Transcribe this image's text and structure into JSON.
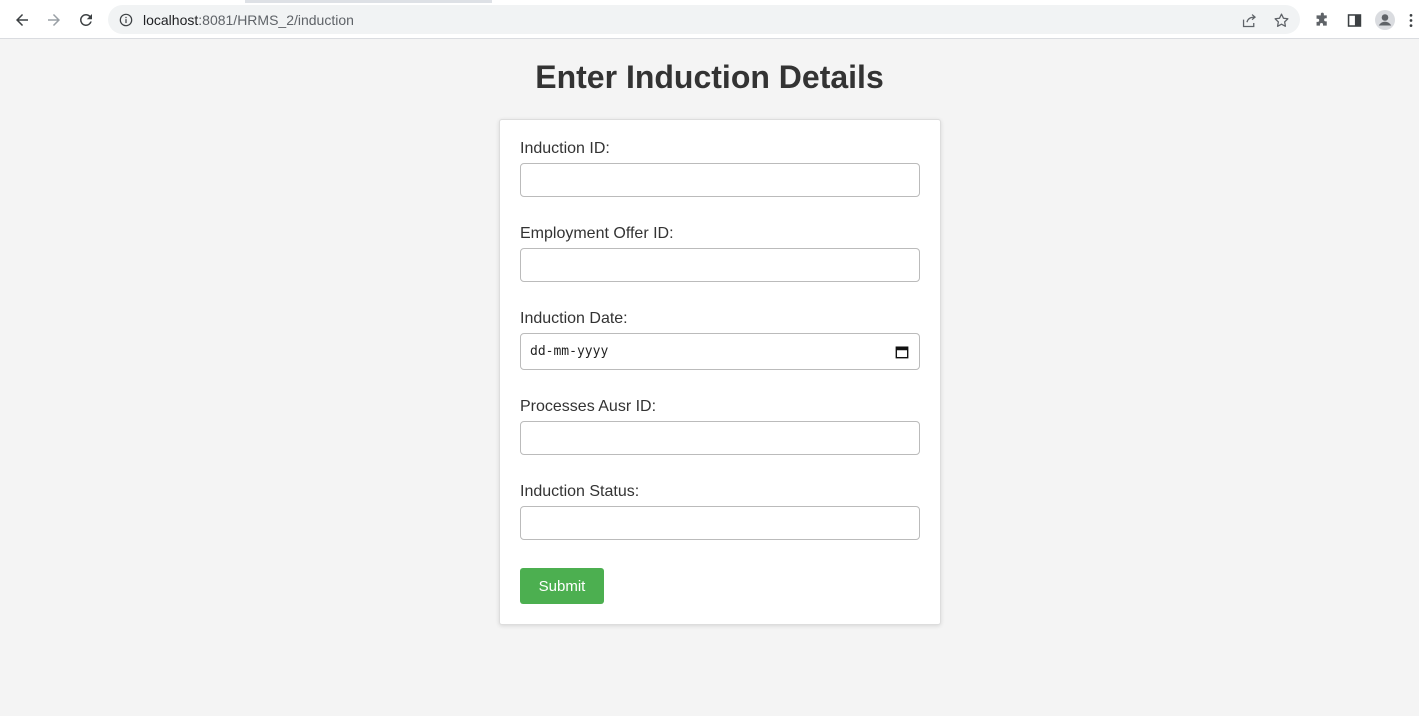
{
  "browser": {
    "url_host": "localhost",
    "url_rest": ":8081/HRMS_2/induction"
  },
  "page": {
    "title": "Enter Induction Details"
  },
  "form": {
    "fields": [
      {
        "label": "Induction ID:",
        "value": ""
      },
      {
        "label": "Employment Offer ID:",
        "value": ""
      },
      {
        "label": "Induction Date:",
        "placeholder": "dd-mm-yyyy"
      },
      {
        "label": "Processes Ausr ID:",
        "value": ""
      },
      {
        "label": "Induction Status:",
        "value": ""
      }
    ],
    "submit_label": "Submit"
  },
  "colors": {
    "submit": "#4caf50",
    "background": "#f4f4f4"
  }
}
